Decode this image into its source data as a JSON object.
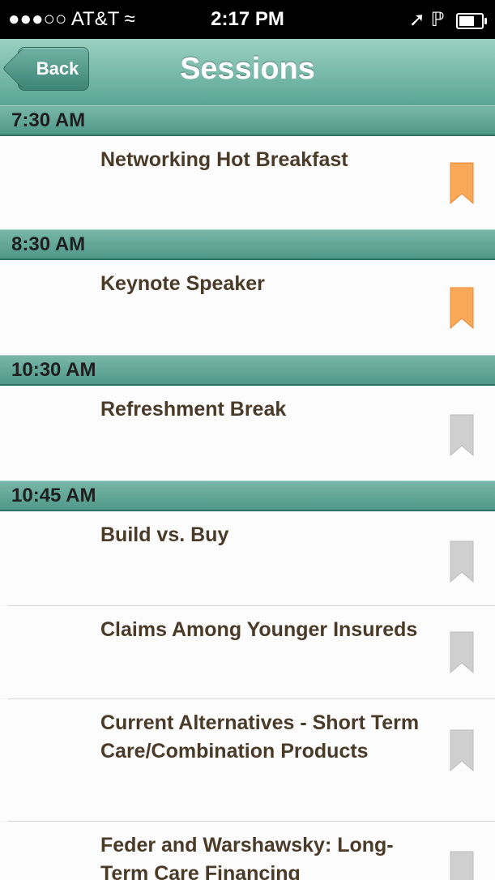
{
  "status_bar": {
    "carrier": "●●●○○ AT&T",
    "time": "2:17 PM"
  },
  "nav": {
    "back_label": "Back",
    "title": "Sessions"
  },
  "colors": {
    "bookmarked": "#f9a857",
    "unbookmarked": "#cfcfcf"
  },
  "sections": [
    {
      "time": "7:30 AM",
      "sessions": [
        {
          "title": "Networking Hot Breakfast",
          "bookmarked": true
        }
      ]
    },
    {
      "time": "8:30 AM",
      "sessions": [
        {
          "title": "Keynote Speaker",
          "bookmarked": true
        }
      ]
    },
    {
      "time": "10:30 AM",
      "sessions": [
        {
          "title": "Refreshment Break",
          "bookmarked": false
        }
      ]
    },
    {
      "time": "10:45 AM",
      "sessions": [
        {
          "title": "Build vs. Buy",
          "bookmarked": false
        },
        {
          "title": "Claims Among Younger Insureds",
          "bookmarked": false
        },
        {
          "title": "Current Alternatives - Short Term Care/Combination Products",
          "bookmarked": false
        },
        {
          "title": "Feder and Warshawsky: Long-Term Care Financing",
          "bookmarked": false
        }
      ]
    }
  ]
}
